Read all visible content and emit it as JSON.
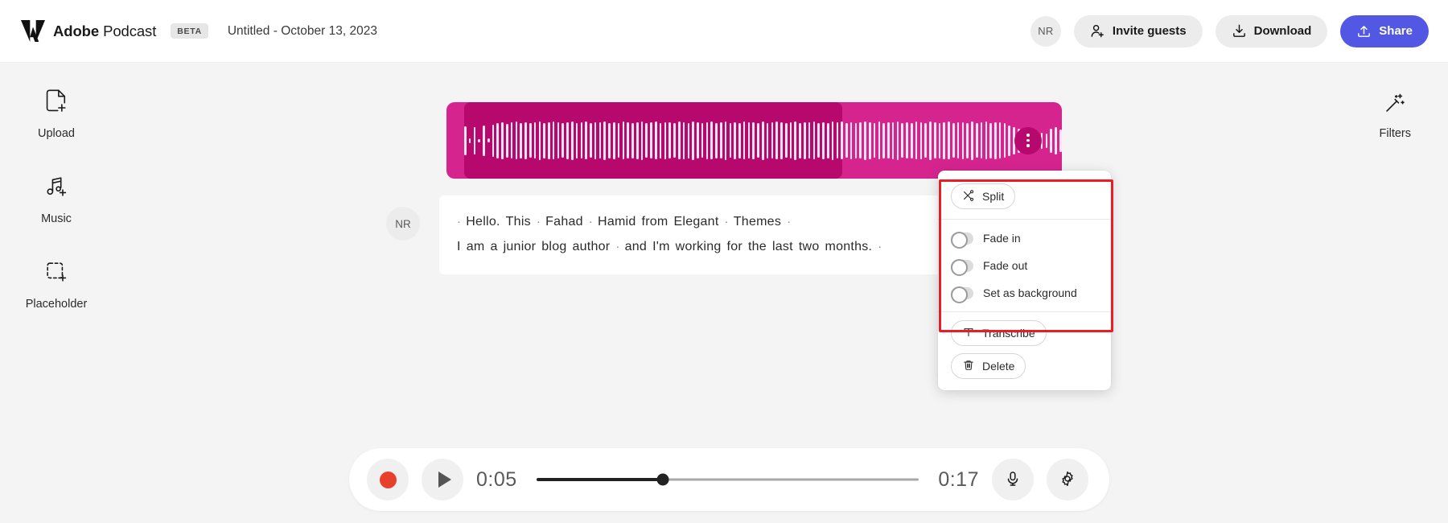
{
  "header": {
    "brand_bold": "Adobe",
    "brand_light": " Podcast",
    "beta": "BETA",
    "doc_title": "Untitled - October 13, 2023",
    "avatar_initials": "NR",
    "invite_label": "Invite guests",
    "download_label": "Download",
    "share_label": "Share",
    "logo_icon": "adobe-logo-icon",
    "invite_icon": "person-add-icon",
    "download_icon": "download-icon",
    "share_icon": "share-upload-icon"
  },
  "colors": {
    "accent_primary": "#5258e4",
    "clip_outer": "#d6248f",
    "clip_inner": "#b7086e",
    "record_red": "#e8412b",
    "highlight_red": "#ec1c24",
    "chip_grey": "#ececec"
  },
  "sidebar": {
    "items": [
      {
        "label": "Upload",
        "icon": "file-add-icon"
      },
      {
        "label": "Music",
        "icon": "music-add-icon"
      },
      {
        "label": "Placeholder",
        "icon": "placeholder-add-icon"
      }
    ]
  },
  "filters": {
    "label": "Filters",
    "icon": "magic-wand-icon"
  },
  "clip": {
    "menu_icon": "more-vertical-icon",
    "waveform_heights": [
      36,
      6,
      34,
      4,
      38,
      5,
      40,
      44,
      46,
      42,
      45,
      47,
      44,
      46,
      43,
      45,
      48,
      44,
      46,
      47,
      45,
      43,
      46,
      48,
      44,
      45,
      47,
      43,
      46,
      45,
      48,
      44,
      46,
      43,
      47,
      45,
      44,
      46,
      48,
      43,
      45,
      47,
      44,
      46,
      45,
      43,
      47,
      46,
      44,
      48,
      45,
      43,
      46,
      47,
      44,
      45,
      48,
      43,
      46,
      44,
      47,
      45,
      46,
      43,
      48,
      44,
      45,
      47,
      46,
      43,
      45,
      48,
      44,
      46,
      45,
      47,
      43,
      46,
      44,
      48,
      45,
      47,
      43,
      46,
      44,
      45,
      48,
      46,
      43,
      47,
      44,
      45,
      46,
      48,
      43,
      45,
      44,
      47,
      46,
      43,
      48,
      45,
      44,
      46,
      47,
      43,
      45,
      46,
      44,
      48,
      43,
      45,
      47,
      44,
      46,
      45,
      43,
      38,
      34,
      30,
      28,
      26,
      24,
      22,
      20,
      18,
      30,
      34,
      28,
      22,
      16,
      26,
      30,
      20,
      14,
      10,
      8,
      6,
      5,
      6,
      5,
      6,
      5,
      6,
      5,
      6,
      5,
      6,
      5,
      6,
      5,
      6,
      5,
      6,
      5,
      6,
      5,
      6,
      5,
      6,
      5,
      6,
      5,
      6,
      5,
      6,
      5,
      6,
      5,
      6,
      5,
      6,
      5,
      6,
      5,
      6,
      5,
      6,
      5,
      6,
      5,
      6
    ]
  },
  "transcript": {
    "speaker_initials": "NR",
    "lines": [
      [
        {
          "t": "·",
          "sep": true
        },
        {
          "t": "Hello."
        },
        {
          "t": "This"
        },
        {
          "t": "·",
          "sep": true
        },
        {
          "t": "Fahad"
        },
        {
          "t": "·",
          "sep": true
        },
        {
          "t": "Hamid"
        },
        {
          "t": "from"
        },
        {
          "t": "Elegant"
        },
        {
          "t": "·",
          "sep": true
        },
        {
          "t": "Themes"
        },
        {
          "t": "·",
          "sep": true
        }
      ],
      [
        {
          "t": "I"
        },
        {
          "t": "am"
        },
        {
          "t": "a"
        },
        {
          "t": "junior"
        },
        {
          "t": "blog"
        },
        {
          "t": "author"
        },
        {
          "t": "·",
          "sep": true
        },
        {
          "t": "and"
        },
        {
          "t": "I'm"
        },
        {
          "t": "working"
        },
        {
          "t": "for"
        },
        {
          "t": "the"
        },
        {
          "t": "last"
        },
        {
          "t": "two"
        },
        {
          "t": "months."
        },
        {
          "t": "·",
          "sep": true
        }
      ]
    ]
  },
  "context_menu": {
    "split_label": "Split",
    "split_icon": "scissors-icon",
    "toggles": [
      {
        "label": "Fade in",
        "on": false
      },
      {
        "label": "Fade out",
        "on": false
      },
      {
        "label": "Set as background",
        "on": false
      }
    ],
    "transcribe_label": "Transcribe",
    "transcribe_icon": "text-t-icon",
    "delete_label": "Delete",
    "delete_icon": "trash-icon"
  },
  "player": {
    "record_icon": "record-circle-icon",
    "play_icon": "play-triangle-icon",
    "current_time": "0:05",
    "total_time": "0:17",
    "progress_percent": 33,
    "mic_icon": "microphone-icon",
    "settings_icon": "gear-icon"
  }
}
